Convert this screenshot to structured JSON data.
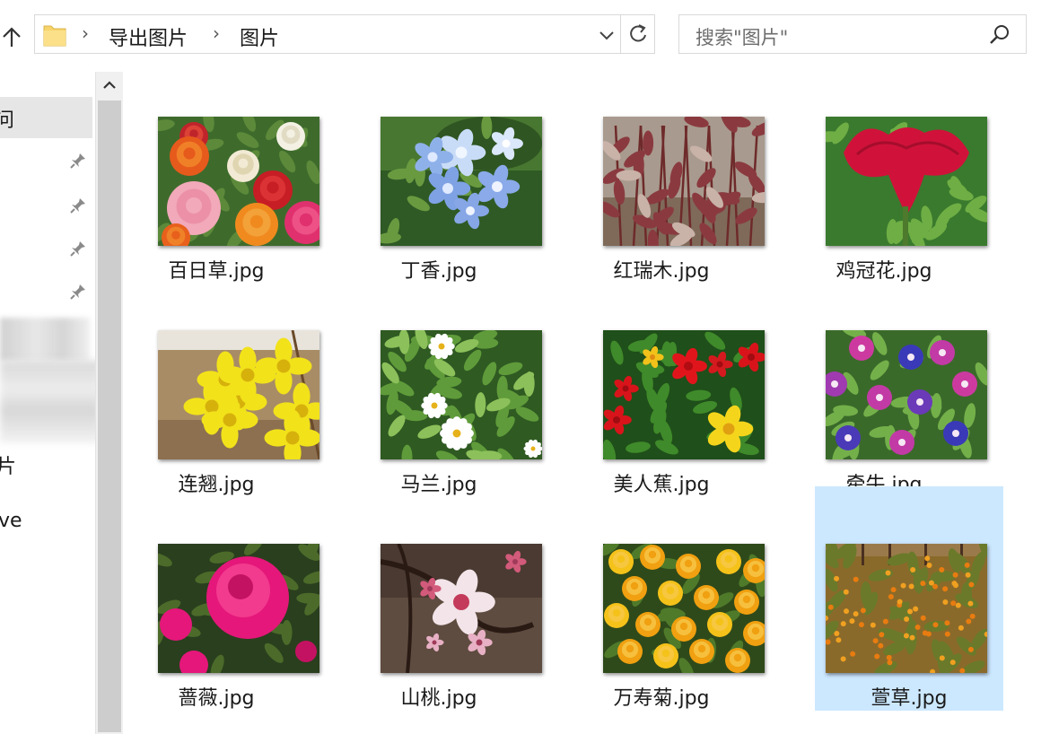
{
  "toolbar": {
    "breadcrumb": [
      "导出图片",
      "图片"
    ],
    "search_placeholder": "搜索\"图片\""
  },
  "nav": {
    "selected_partial": "问",
    "items": [
      "片",
      "ve"
    ]
  },
  "files": [
    {
      "name": "百日草.jpg",
      "thumb": "zinnia",
      "selected": false
    },
    {
      "name": "丁香.jpg",
      "thumb": "lilac",
      "selected": false
    },
    {
      "name": "红瑞木.jpg",
      "thumb": "dogwood",
      "selected": false
    },
    {
      "name": "鸡冠花.jpg",
      "thumb": "celosia",
      "selected": false
    },
    {
      "name": "连翘.jpg",
      "thumb": "forsythia",
      "selected": false
    },
    {
      "name": "马兰.jpg",
      "thumb": "daisy",
      "selected": false
    },
    {
      "name": "美人蕉.jpg",
      "thumb": "canna",
      "selected": false
    },
    {
      "name": "牵牛.jpg",
      "thumb": "morning-glory",
      "selected": false
    },
    {
      "name": "蔷薇.jpg",
      "thumb": "rose",
      "selected": false
    },
    {
      "name": "山桃.jpg",
      "thumb": "peach-blossom",
      "selected": false
    },
    {
      "name": "万寿菊.jpg",
      "thumb": "marigold",
      "selected": false
    },
    {
      "name": "萱草.jpg",
      "thumb": "daylily",
      "selected": true
    }
  ]
}
